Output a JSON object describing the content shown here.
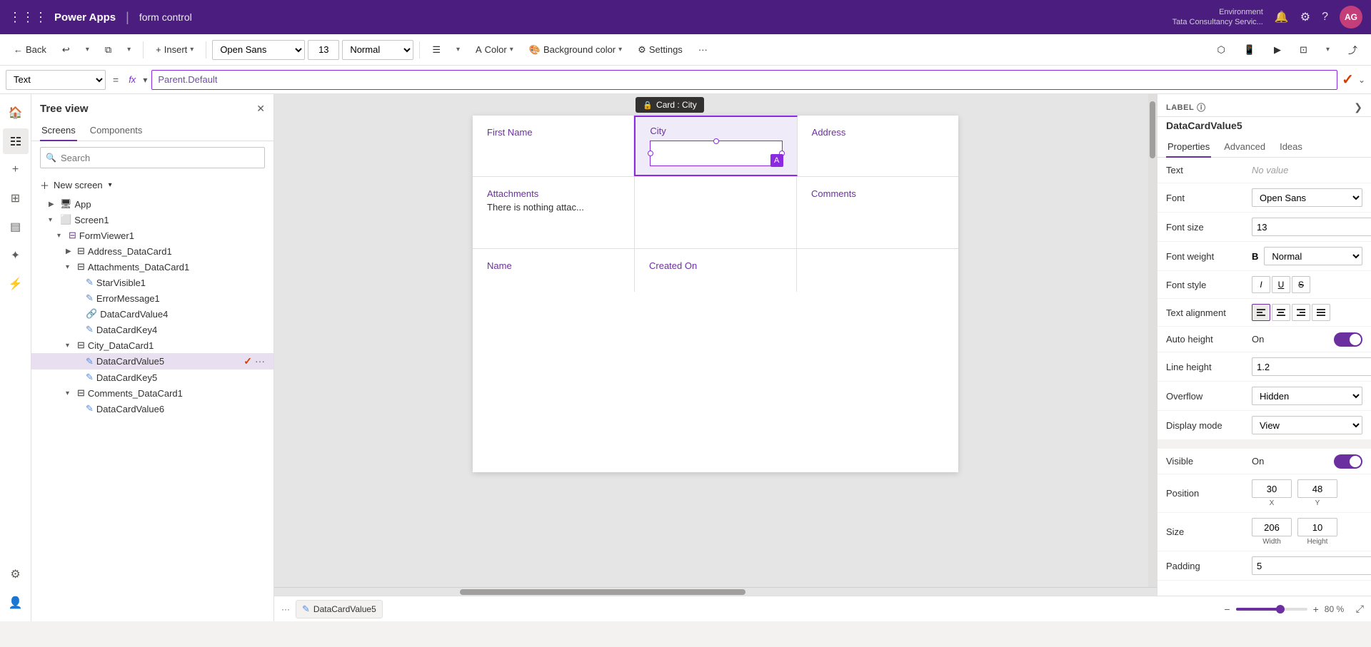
{
  "app": {
    "name": "Power Apps",
    "separator": "|",
    "title": "form control",
    "env_label": "Environment",
    "env_name": "Tata Consultancy Servic...",
    "avatar_initials": "AG"
  },
  "second_toolbar": {
    "back_label": "Back",
    "insert_label": "Insert",
    "font_family": "Open Sans",
    "font_size": "13",
    "font_weight": "Normal",
    "color_label": "Color",
    "bg_color_label": "Background color",
    "settings_label": "Settings"
  },
  "formula_bar": {
    "property": "Text",
    "formula": "Parent.Default"
  },
  "tree_view": {
    "title": "Tree view",
    "tabs": [
      "Screens",
      "Components"
    ],
    "active_tab": "Screens",
    "search_placeholder": "Search",
    "new_screen_label": "New screen",
    "items": [
      {
        "label": "App",
        "type": "app",
        "indent": 1,
        "expanded": false
      },
      {
        "label": "Screen1",
        "type": "screen",
        "indent": 1,
        "expanded": true
      },
      {
        "label": "FormViewer1",
        "type": "form",
        "indent": 2,
        "expanded": true
      },
      {
        "label": "Address_DataCard1",
        "type": "card",
        "indent": 3,
        "expanded": false
      },
      {
        "label": "Attachments_DataCard1",
        "type": "card",
        "indent": 3,
        "expanded": true
      },
      {
        "label": "StarVisible1",
        "type": "input",
        "indent": 4
      },
      {
        "label": "ErrorMessage1",
        "type": "input",
        "indent": 4
      },
      {
        "label": "DataCardValue4",
        "type": "datacard",
        "indent": 4
      },
      {
        "label": "DataCardKey4",
        "type": "input",
        "indent": 4
      },
      {
        "label": "City_DataCard1",
        "type": "card",
        "indent": 3,
        "expanded": true
      },
      {
        "label": "DataCardValue5",
        "type": "input",
        "indent": 4,
        "selected": true,
        "checkmark": true
      },
      {
        "label": "DataCardKey5",
        "type": "input",
        "indent": 4
      },
      {
        "label": "Comments_DataCard1",
        "type": "card",
        "indent": 3,
        "expanded": true
      },
      {
        "label": "DataCardValue6",
        "type": "input",
        "indent": 4
      }
    ]
  },
  "canvas": {
    "form_rows": [
      {
        "cells": [
          {
            "label": "First Name",
            "content": ""
          },
          {
            "label": "City",
            "content": "",
            "selected": true
          },
          {
            "label": "Address",
            "content": ""
          }
        ]
      },
      {
        "cells": [
          {
            "label": "Attachments",
            "content": "There is nothing attac..."
          },
          {
            "label": "",
            "content": ""
          },
          {
            "label": "Comments",
            "content": ""
          }
        ]
      },
      {
        "cells": [
          {
            "label": "Name",
            "content": ""
          },
          {
            "label": "Created On",
            "content": ""
          },
          {
            "label": "",
            "content": ""
          }
        ]
      }
    ],
    "card_tooltip": "Card : City"
  },
  "bottom_bar": {
    "tab_label": "DataCardValue5",
    "zoom_level": "80 %",
    "zoom_value": 80
  },
  "right_panel": {
    "label": "LABEL",
    "component_name": "DataCardValue5",
    "tabs": [
      "Properties",
      "Advanced",
      "Ideas"
    ],
    "active_tab": "Properties",
    "properties": {
      "text_label": "Text",
      "text_value": "No value",
      "font_label": "Font",
      "font_value": "Open Sans",
      "font_size_label": "Font size",
      "font_size_value": "13",
      "font_weight_label": "Font weight",
      "font_weight_value": "Normal",
      "font_style_label": "Font style",
      "text_align_label": "Text alignment",
      "auto_height_label": "Auto height",
      "auto_height_value": "On",
      "line_height_label": "Line height",
      "line_height_value": "1.2",
      "overflow_label": "Overflow",
      "overflow_value": "Hidden",
      "display_mode_label": "Display mode",
      "display_mode_value": "View",
      "visible_label": "Visible",
      "visible_value": "On",
      "position_label": "Position",
      "position_x": "30",
      "position_y": "48",
      "x_label": "X",
      "y_label": "Y",
      "size_label": "Size",
      "size_width": "206",
      "size_height": "10",
      "width_label": "Width",
      "height_label": "Height",
      "padding_label": "Padding",
      "padding_value": "5"
    }
  }
}
